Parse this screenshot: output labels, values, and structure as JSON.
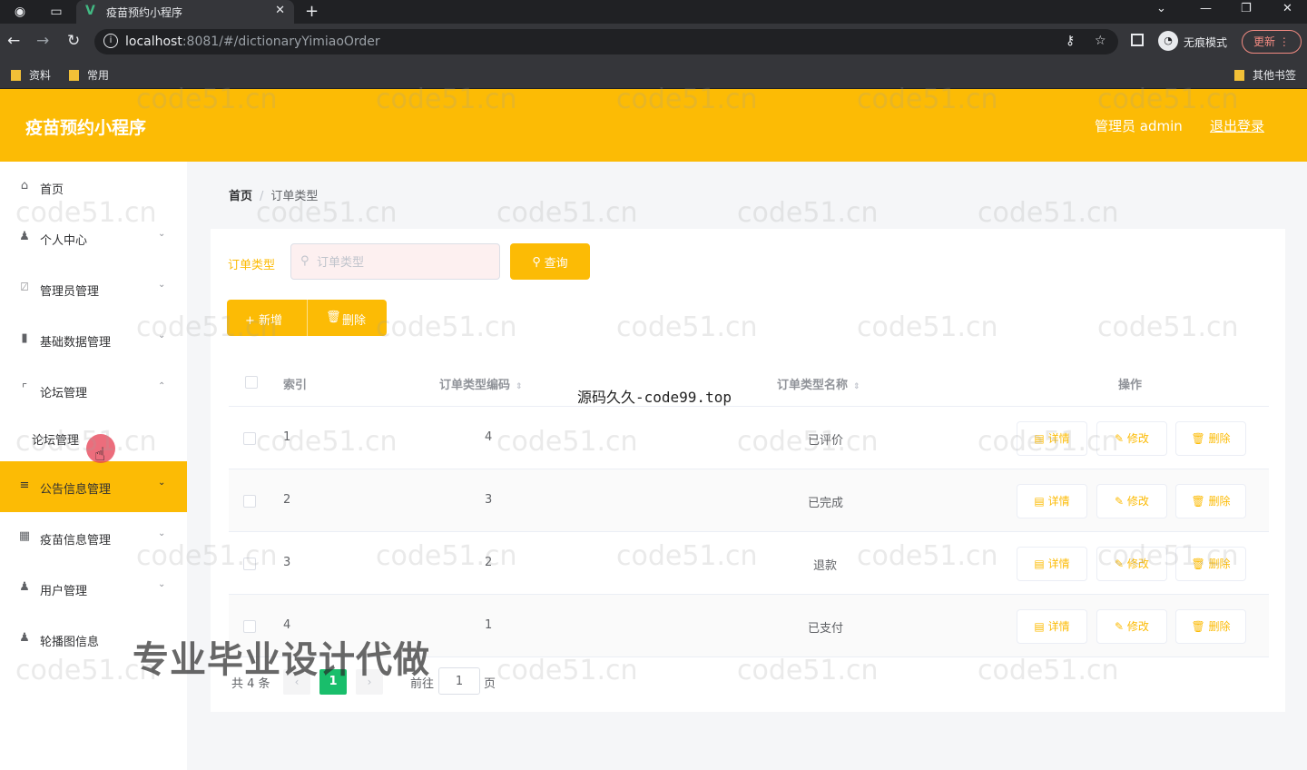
{
  "browser": {
    "tab_title": "疫苗预约小程序",
    "url_host": "localhost",
    "url_rest": ":8081/#/dictionaryYimiaoOrder",
    "incognito_label": "无痕模式",
    "update_label": "更新",
    "bookmarks": [
      "资料",
      "常用"
    ],
    "other_bookmarks": "其他书签"
  },
  "header": {
    "title": "疫苗预约小程序",
    "admin": "管理员 admin",
    "logout": "退出登录"
  },
  "sidebar": {
    "items": [
      {
        "label": "首页"
      },
      {
        "label": "个人中心"
      },
      {
        "label": "管理员管理"
      },
      {
        "label": "基础数据管理"
      },
      {
        "label": "论坛管理"
      },
      {
        "label": "公告信息管理"
      },
      {
        "label": "疫苗信息管理"
      },
      {
        "label": "用户管理"
      },
      {
        "label": "轮播图信息"
      }
    ],
    "submenu": [
      {
        "label": "论坛管理"
      }
    ]
  },
  "breadcrumb": {
    "home": "首页",
    "separator": "/",
    "current": "订单类型"
  },
  "search": {
    "label": "订单类型",
    "placeholder": "订单类型",
    "query_button": "查询"
  },
  "actions": {
    "add": "+ 新增",
    "delete": "删除"
  },
  "table": {
    "columns": [
      "索引",
      "订单类型编码",
      "订单类型名称",
      "操作"
    ],
    "rows": [
      {
        "index": "1",
        "code": "4",
        "name": "已评价"
      },
      {
        "index": "2",
        "code": "3",
        "name": "已完成"
      },
      {
        "index": "3",
        "code": "2",
        "name": "退款"
      },
      {
        "index": "4",
        "code": "1",
        "name": "已支付"
      }
    ],
    "row_actions": {
      "detail": "详情",
      "edit": "修改",
      "remove": "删除"
    }
  },
  "pagination": {
    "total": "共 4 条",
    "current_page": "1",
    "goto_label": "前往",
    "goto_value": "1",
    "page_suffix": "页"
  },
  "overlay": {
    "center_text": "源码久久-code99.top",
    "big_text": "专业毕业设计代做",
    "watermark": "code51.cn"
  },
  "colors": {
    "accent": "#fcbb05",
    "pager_active": "#19be6b"
  }
}
